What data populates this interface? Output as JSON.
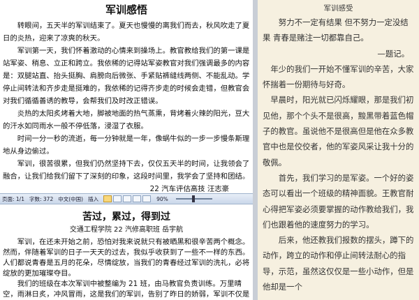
{
  "left_top_doc": {
    "title": "军训感悟",
    "paragraphs": [
      "转眼间，五天半的军训结束了。夏天也慢慢的离我们而去，秋风吹走了夏日的炎热，迎来了凉爽的秋天。",
      "军训第一天，我们怀着激动的心情来到操场上。教官教给我们的第一课是站军姿、稍息、立正和跨立。我依稀的记得站军姿教官对我们强调最多的内容是：双腿站直、抬头挺胸、肩膀向后微张、手紧贴裤缝线两侧、不能乱动。学停止间转法和齐步走是挺难的，我依稀的记得齐步走的时候会走错，但教官会对我们循循善诱的教导，会帮我们及时改正错误。",
      "炎热的太阳炙烤着大地，脚被地面的热气蒸熏，背烤着火辣的阳光，豆大的汗水如同雨水一般不停低落，浸湿了衣服。",
      "时间一分一秒的流逝，每一分钟就是一年，像蜗牛似的一步一步慢条斯理地从身边偷过。",
      "军训，很苦很累，但我们仍然坚持下去，仅仅五天半的时间，让我领会了融合，让我们给我们留下了深刻的印象，这段时间里，我学会了坚持和团结。"
    ],
    "signature": "22 汽车评估高技  汪志豪"
  },
  "status_bar": {
    "page": "页面: 1/1",
    "words": "字数: 372",
    "language": "中文(中国)",
    "mode": "插入",
    "zoom": "90%",
    "zoom_level": 0.45
  },
  "left_bottom_doc": {
    "title": "苦过，累过，得到过",
    "byline": "交通工程学院  22 汽修高职班  岳宇航",
    "paragraphs": [
      "军训，在还未开始之前，恐怕对我来说就只有被晒黑和很辛苦两个概念。然而，伴随着军训的日子一天天的过去，我似乎收获到了一些不一样的东西。人们都说青春是五月的花朵，尽情绽放，当我们的青春经过军训的洗礼，必将绽放的更加璀璨夺目。",
      "我们的班级在本次军训中被整编为 21 班，由马教官负责训练。万里晴空，雨淋日炙，冲风冒雨，这是我们的军训，告别了昨日的娇弱，军训不仅是"
    ]
  },
  "right_doc": {
    "title": "军训感受",
    "paragraphs": [
      "努力不一定有结果 但不努力一定没结果 青春是赌注一切都靠自己。",
      "年少的我们一开始不懂军训的辛苦，大家怀揣着一份期待与好奇。",
      "早晨时，阳光就已闪烁耀眼，那是我们初见他，那个个头不是很高，黢黑带着蓝色帽子的教官。虽说他不是很高但是他在众多教官中也是佼佼者，他的军姿风采让我十分的敬佩。",
      "首先，我们学习的是军姿。一个好的姿态可以看出一个班级的精神面貌。王教官耐心得把军姿必须要掌握的动作教给我们，我们也跟着他的速度努力的学习。",
      "后来，他还教我们报数的摆头，蹲下的动作，跨立的动作和停止间转法耐心的指导，示范，虽然这仅仅是一些小动作，但是他却是一个"
    ],
    "author": "—题记。"
  }
}
